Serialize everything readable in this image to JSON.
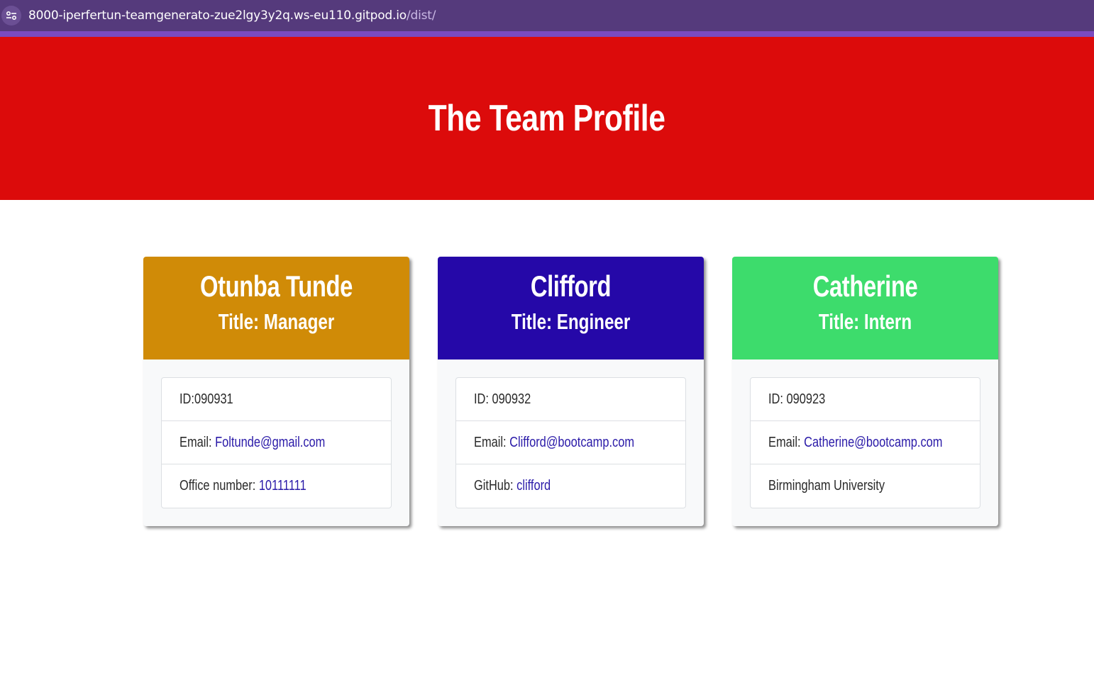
{
  "browser": {
    "url_host": "8000-iperfertun-teamgenerato-zue2lgy3y2q.ws-eu110.gitpod.io",
    "url_path": "/dist/"
  },
  "page": {
    "title": "The Team Profile"
  },
  "colors": {
    "hero": "#dc0b0b",
    "manager": "#d08b07",
    "engineer": "#2508a8",
    "intern": "#3ddc6c",
    "link": "#2a1aa8"
  },
  "cards": [
    {
      "name": "Otunba Tunde",
      "title": "Title: Manager",
      "id": "ID:090931",
      "email_label": "Email: ",
      "email": "Foltunde@gmail.com",
      "extra_label": "Office number: ",
      "extra_value": "10111111"
    },
    {
      "name": "Clifford",
      "title": "Title: Engineer",
      "id": "ID: 090932",
      "email_label": "Email: ",
      "email": "Clifford@bootcamp.com",
      "extra_label": "GitHub: ",
      "extra_value": "clifford"
    },
    {
      "name": "Catherine",
      "title": "Title: Intern",
      "id": "ID: 090923",
      "email_label": "Email: ",
      "email": "Catherine@bootcamp.com",
      "extra_label": "Birmingham University",
      "extra_value": ""
    }
  ]
}
